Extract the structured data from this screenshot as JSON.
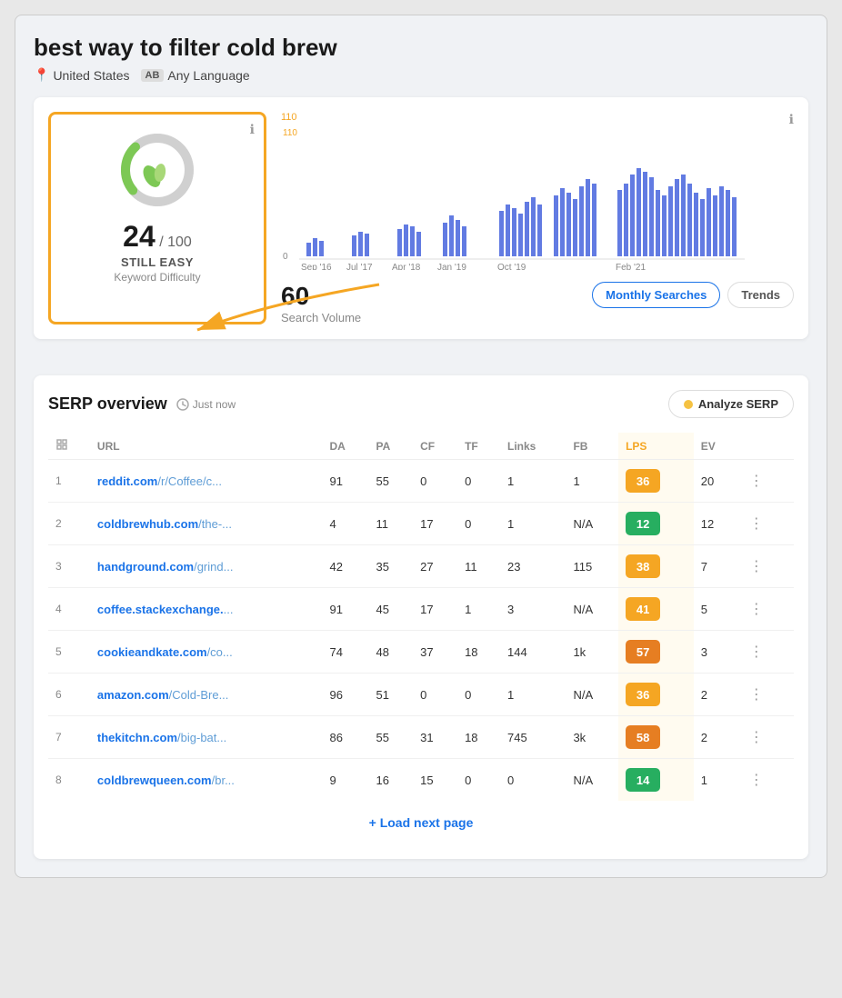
{
  "page": {
    "title": "best way to filter cold brew",
    "location": "United States",
    "language_badge": "AB",
    "language_label": "Any Language"
  },
  "kd_card": {
    "score": "24",
    "max": "100",
    "label": "STILL EASY",
    "sublabel": "Keyword Difficulty",
    "info": "ℹ"
  },
  "chart": {
    "y_top": "110",
    "y_bottom": "0",
    "x_labels": [
      "Sep '16",
      "Jul '17",
      "Apr '18",
      "Jan '19",
      "Oct '19",
      "Feb '21"
    ],
    "search_volume": "60",
    "search_volume_label": "Search Volume",
    "tab_monthly": "Monthly Searches",
    "tab_trends": "Trends",
    "info": "ℹ"
  },
  "serp": {
    "title": "SERP overview",
    "time_label": "Just now",
    "analyze_btn": "Analyze SERP",
    "load_next": "+ Load next page",
    "columns": [
      "",
      "URL",
      "DA",
      "PA",
      "CF",
      "TF",
      "Links",
      "FB",
      "LPS",
      "EV",
      ""
    ],
    "rows": [
      {
        "rank": "1",
        "domain": "reddit.com",
        "path": "/r/Coffee/c...",
        "da": "91",
        "pa": "55",
        "cf": "0",
        "tf": "0",
        "links": "1",
        "fb": "1",
        "lps": "36",
        "lps_color": "yellow",
        "ev": "20"
      },
      {
        "rank": "2",
        "domain": "coldbrewhub.com",
        "path": "/the-...",
        "da": "4",
        "pa": "11",
        "cf": "17",
        "tf": "0",
        "links": "1",
        "fb": "N/A",
        "lps": "12",
        "lps_color": "green",
        "ev": "12"
      },
      {
        "rank": "3",
        "domain": "handground.com",
        "path": "/grind...",
        "da": "42",
        "pa": "35",
        "cf": "27",
        "tf": "11",
        "links": "23",
        "fb": "115",
        "lps": "38",
        "lps_color": "yellow",
        "ev": "7"
      },
      {
        "rank": "4",
        "domain": "coffee.stackexchange.",
        "path": "...",
        "da": "91",
        "pa": "45",
        "cf": "17",
        "tf": "1",
        "links": "3",
        "fb": "N/A",
        "lps": "41",
        "lps_color": "yellow",
        "ev": "5"
      },
      {
        "rank": "5",
        "domain": "cookieandkate.com",
        "path": "/co...",
        "da": "74",
        "pa": "48",
        "cf": "37",
        "tf": "18",
        "links": "144",
        "fb": "1k",
        "lps": "57",
        "lps_color": "orange",
        "ev": "3"
      },
      {
        "rank": "6",
        "domain": "amazon.com",
        "path": "/Cold-Bre...",
        "da": "96",
        "pa": "51",
        "cf": "0",
        "tf": "0",
        "links": "1",
        "fb": "N/A",
        "lps": "36",
        "lps_color": "yellow",
        "ev": "2"
      },
      {
        "rank": "7",
        "domain": "thekitchn.com",
        "path": "/big-bat...",
        "da": "86",
        "pa": "55",
        "cf": "31",
        "tf": "18",
        "links": "745",
        "fb": "3k",
        "lps": "58",
        "lps_color": "orange",
        "ev": "2"
      },
      {
        "rank": "8",
        "domain": "coldbrewqueen.com",
        "path": "/br...",
        "da": "9",
        "pa": "16",
        "cf": "15",
        "tf": "0",
        "links": "0",
        "fb": "N/A",
        "lps": "14",
        "lps_color": "green",
        "ev": "1"
      }
    ]
  }
}
